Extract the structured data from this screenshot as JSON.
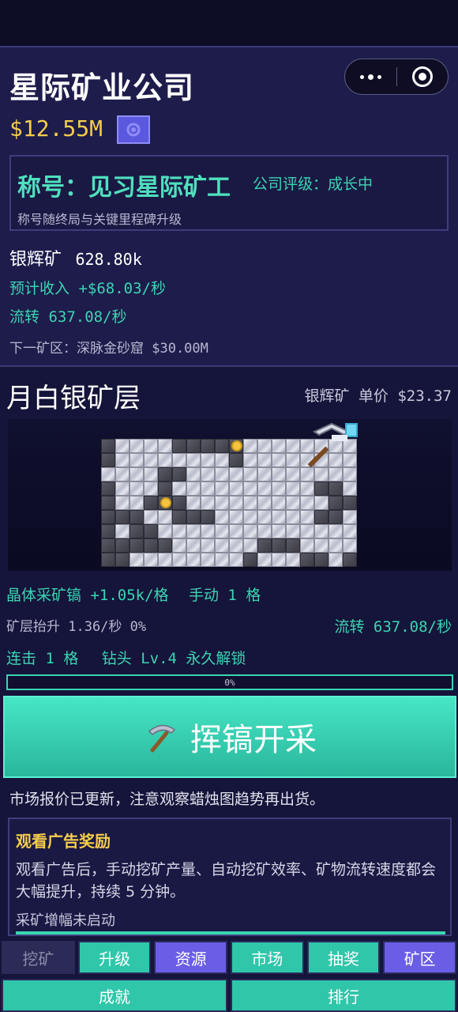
{
  "header": {
    "app_title": "星际矿业公司",
    "money": "$12.55M",
    "capsule": {
      "more_icon": "more-dots-icon",
      "close_icon": "target-icon"
    }
  },
  "title_card": {
    "title": "称号：见习星际矿工",
    "rating": "公司评级：成长中",
    "hint": "称号随终局与关键里程碑升级"
  },
  "stats": {
    "ore_label": "银辉矿",
    "ore_amount": "628.80k",
    "income": "预计收入 +$68.03/秒",
    "flow": "流转 637.08/秒",
    "next_zone": "下一矿区：深脉金砂窟 $30.00M"
  },
  "layer": {
    "name": "月白银矿层",
    "price": "银辉矿  单价 $23.37"
  },
  "mining": {
    "pickaxe": "晶体采矿镐 +1.05k/格",
    "manual": "手动 1 格",
    "lift": "矿层抬升 1.36/秒  0%",
    "flow": "流转 637.08/秒",
    "combo": "连击 1 格",
    "drill": "钻头 Lv.4 永久解锁",
    "progress_label": "0%",
    "progress": 0
  },
  "action_button": {
    "icon": "pickaxe-icon",
    "label": "挥镐开采"
  },
  "notice": "市场报价已更新，注意观察蜡烛图趋势再出货。",
  "ad": {
    "title": "观看广告奖励",
    "description": "观看广告后，手动挖矿产量、自动挖矿效率、矿物流转速度都会大幅提升，持续 5 分钟。",
    "status": "采矿增幅未启动"
  },
  "tabs": [
    "挖矿",
    "升级",
    "资源",
    "市场",
    "抽奖",
    "矿区"
  ],
  "bottom_tabs": [
    "成就",
    "排行"
  ],
  "colors": {
    "accent_teal": "#3dd4b2",
    "money_gold": "#f6cd4c",
    "accent_purple": "#6a5ee6"
  }
}
